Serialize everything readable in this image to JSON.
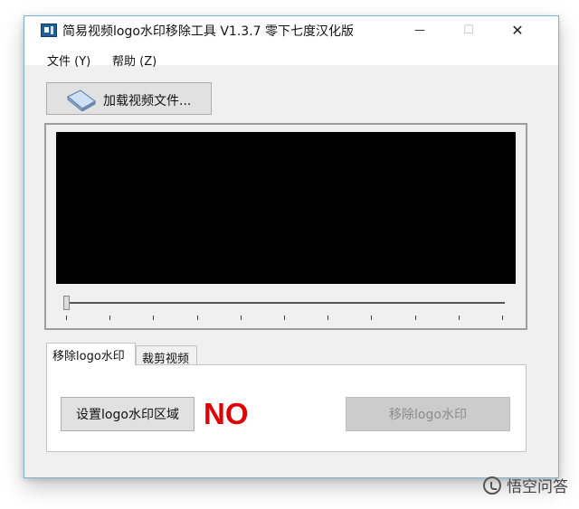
{
  "window": {
    "title": "简易视频logo水印移除工具 V1.3.7 零下七度汉化版",
    "minimize_glyph": "—",
    "maximize_glyph": "☐",
    "close_glyph": "✕"
  },
  "menu": {
    "items": [
      {
        "label": "文件 (Y)"
      },
      {
        "label": "帮助 (Z)"
      }
    ]
  },
  "toolbar": {
    "load_label": "加载视频文件...",
    "load_icon": "eraser-icon"
  },
  "player": {
    "screen_color": "#000000",
    "slider_position": 0
  },
  "tabs": [
    {
      "label": "移除logo水印",
      "active": true
    },
    {
      "label": "裁剪视频",
      "active": false
    }
  ],
  "panel": {
    "set_area_label": "设置logo水印区域",
    "status_text": "NO",
    "status_color": "#e00000",
    "remove_label": "移除logo水印",
    "remove_enabled": false
  },
  "watermark": {
    "text": "悟空问答"
  }
}
